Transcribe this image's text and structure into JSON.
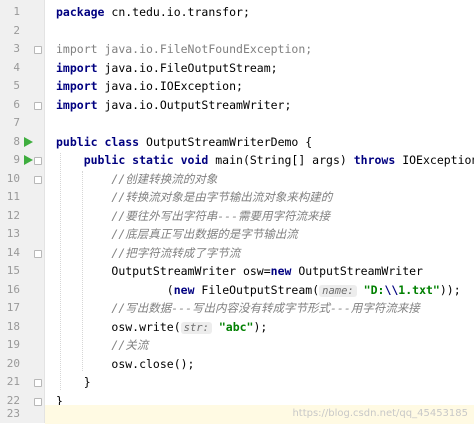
{
  "editor": {
    "line_numbers": [
      "1",
      "2",
      "3",
      "4",
      "5",
      "6",
      "7",
      "8",
      "9",
      "10",
      "11",
      "12",
      "13",
      "14",
      "15",
      "16",
      "17",
      "18",
      "19",
      "20",
      "21",
      "22",
      "23"
    ],
    "code": {
      "l1_kw": "package",
      "l1_rest": " cn.tedu.io.transfor;",
      "l3_kw": "import",
      "l3_rest": " java.io.FileNotFoundException;",
      "l4_kw": "import",
      "l4_rest": " java.io.FileOutputStream;",
      "l5_kw": "import",
      "l5_rest": " java.io.IOException;",
      "l6_kw": "import",
      "l6_rest": " java.io.OutputStreamWriter;",
      "l8_kw": "public class",
      "l8_rest": " OutputStreamWriterDemo {",
      "l9_kw1": "public static void",
      "l9_mid": " main(String[] args) ",
      "l9_kw2": "throws",
      "l9_rest": " IOException {",
      "l10_comment": "//创建转换流的对象",
      "l11_comment": "//转换流对象是由字节输出流对象来构建的",
      "l12_comment": "//要往外写出字符串---需要用字符流来接",
      "l13_comment": "//底层真正写出数据的是字节输出流",
      "l14_comment": "//把字符流转成了字节流",
      "l15_a": "OutputStreamWriter osw=",
      "l15_kw": "new",
      "l15_b": " OutputStreamWriter",
      "l16_open": "(",
      "l16_kw": "new",
      "l16_a": " FileOutputStream(",
      "l16_hint": "name:",
      "l16_str1": " \"D:",
      "l16_esc": "\\\\",
      "l16_str2": "1.txt\"",
      "l16_end": "));",
      "l17_comment": "//写出数据---写出内容没有转成字节形式---用字符流来接",
      "l18_a": "osw.write(",
      "l18_hint": "str:",
      "l18_str": " \"abc\"",
      "l18_end": ");",
      "l19_comment": "//关流",
      "l20_a": "osw.close();",
      "l21": "}",
      "l22": "}"
    },
    "gutter_icons": {
      "run": "run-triangle-icon",
      "fold": "fold-marker-icon"
    },
    "colors": {
      "keyword": "#000080",
      "comment": "#808080",
      "string": "#008000",
      "run_icon": "#3fae3f",
      "current_line": "#fffae3"
    }
  },
  "watermark": "https://blog.csdn.net/qq_45453185"
}
